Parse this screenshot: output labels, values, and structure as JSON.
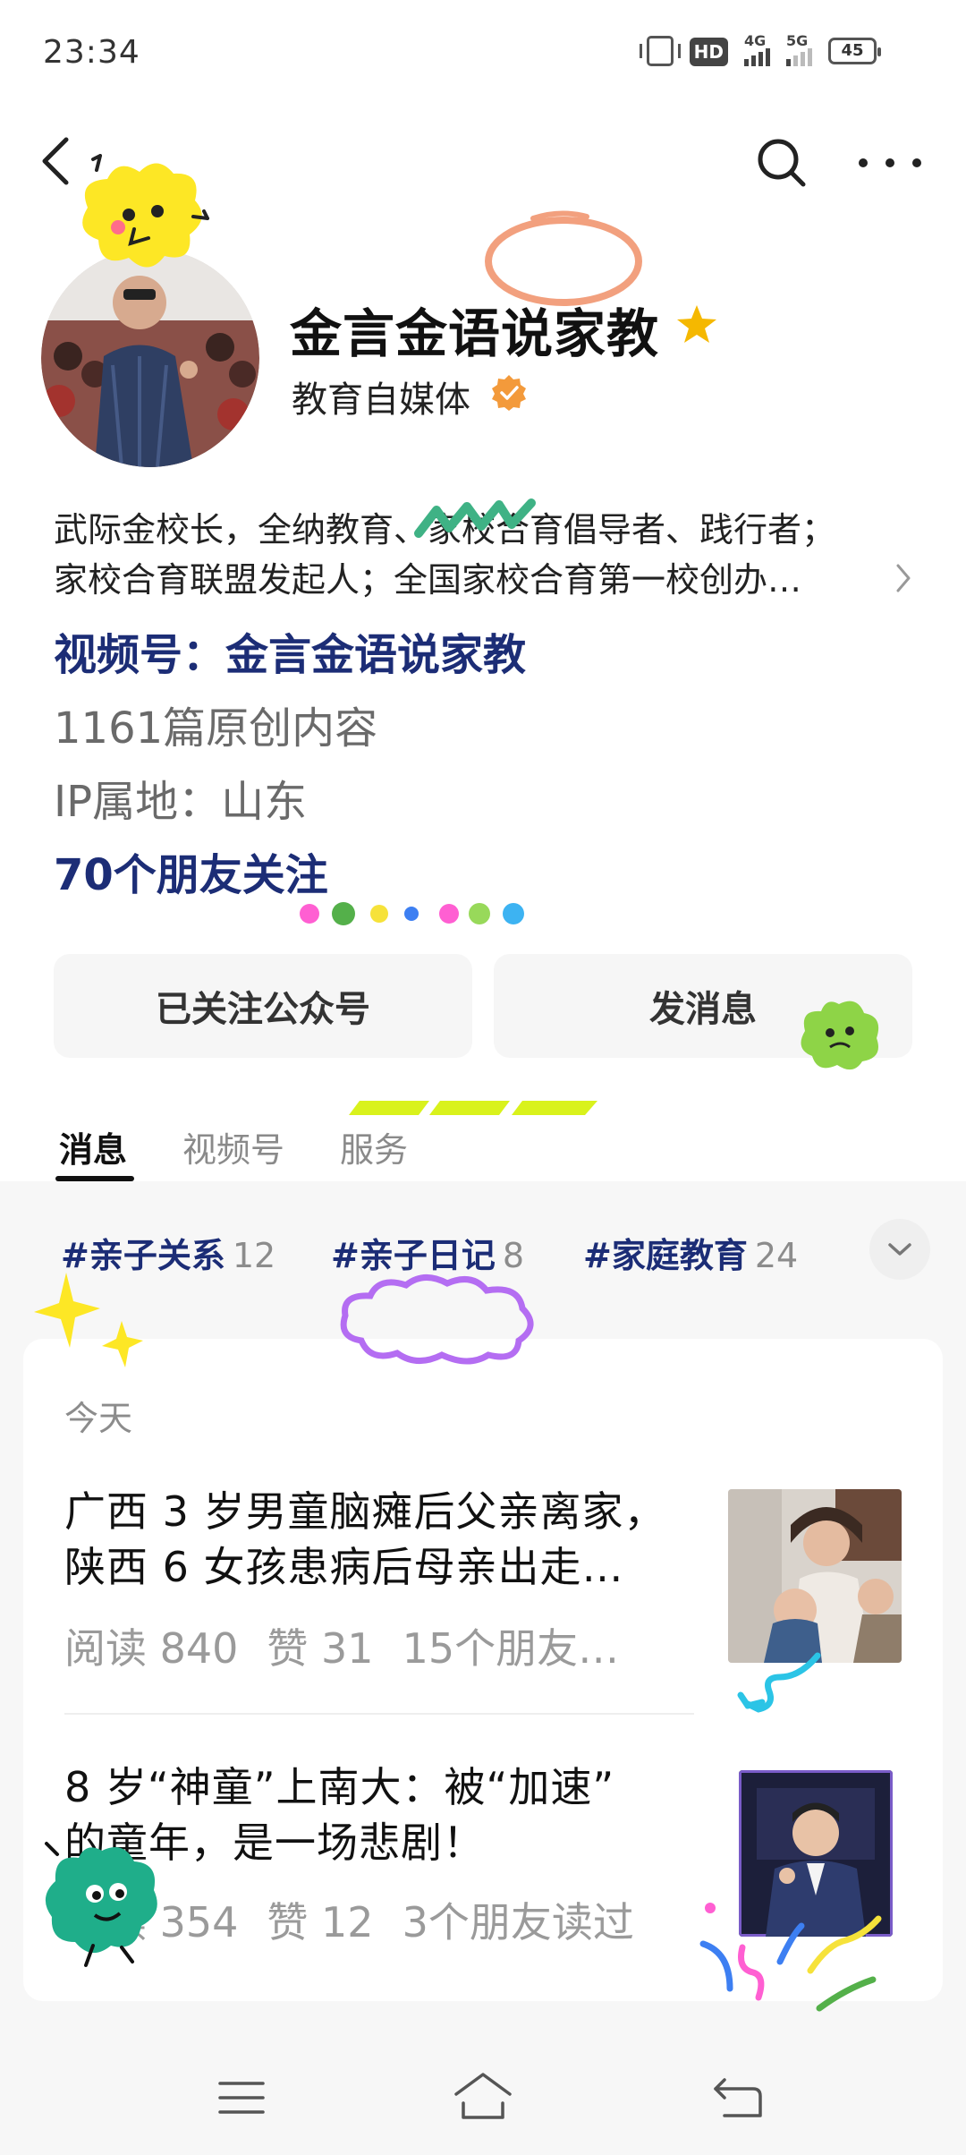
{
  "status_bar": {
    "time": "23:34",
    "hd_label": "HD",
    "sim1_label": "4G",
    "sim2_label": "5G",
    "battery": "45"
  },
  "profile": {
    "name": "金言金语说家教",
    "type": "教育自媒体",
    "bio_line1": "武际金校长，全纳教育、家校合育倡导者、践行者；",
    "bio_line2": "家校合育联盟发起人；全国家校合育第一校创办…",
    "video_account": "视频号：金言金语说家教",
    "original_count": "1161篇原创内容",
    "ip_location": "IP属地：山东",
    "friends_follow": "70个朋友关注"
  },
  "buttons": {
    "followed": "已关注公众号",
    "message": "发消息"
  },
  "tabs": [
    {
      "label": "消息",
      "active": true
    },
    {
      "label": "视频号",
      "active": false
    },
    {
      "label": "服务",
      "active": false
    }
  ],
  "tags": [
    {
      "name": "#亲子关系",
      "count": "12"
    },
    {
      "name": "#亲子日记",
      "count": "8"
    },
    {
      "name": "#家庭教育",
      "count": "24"
    }
  ],
  "feed": {
    "section_label": "今天",
    "articles": [
      {
        "title_line1": "广西 3 岁男童脑瘫后父亲离家，",
        "title_line2": "陕西 6 女孩患病后母亲出走…",
        "reads": "阅读 840",
        "likes": "赞 31",
        "friends": "15个朋友…"
      },
      {
        "title_line1": "8 岁“神童”上南大：被“加速”",
        "title_line2": "的童年，是一场悲剧！",
        "reads": "阅读 354",
        "likes": "赞 12",
        "friends": "3个朋友读过"
      }
    ]
  },
  "icons": {
    "back": "back-arrow-icon",
    "search": "search-icon",
    "more": "more-icon",
    "star": "star-icon",
    "verified": "verified-badge-icon",
    "expand": "chevron-down-icon"
  },
  "colors": {
    "link_blue": "#1c2d76",
    "star_gold": "#f5b800",
    "verified_orange": "#f39a3b",
    "muted_gray": "#8c8c8c"
  }
}
